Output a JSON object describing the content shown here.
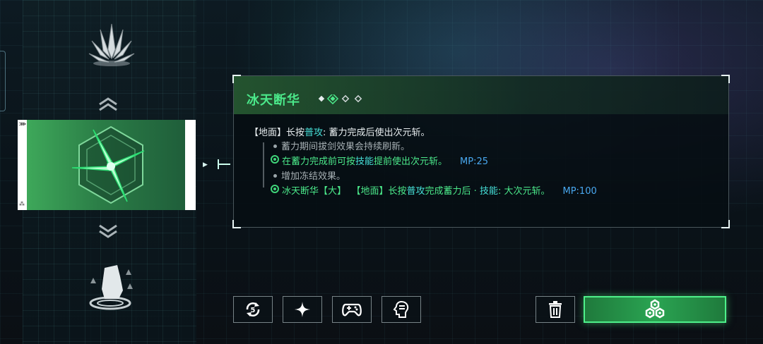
{
  "icons": {
    "crystal": "frost-crystal-icon",
    "skill": "crossed-blades-skill-icon",
    "foot": "dash-foot-icon",
    "chev_up": "chevron-up-icon",
    "chev_down": "chevron-down-icon"
  },
  "skill": {
    "name": "冰天断华",
    "level_markers": 4,
    "active_level": 2
  },
  "description": {
    "l1": {
      "a": "【地面】长按",
      "b": "普攻",
      "c": ": 蓄力完成后使出次元斩。"
    },
    "l2": "蓄力期间拔剑效果会持续刷新。",
    "l3": {
      "a": "在蓄力完成前可按",
      "b": "技能",
      "c": "提前使出次元斩。",
      "mp": "MP:25"
    },
    "l4": "增加冻结效果。",
    "l5": {
      "a": "冰天断华【大】",
      "b": "【地面】长按",
      "c": "普攻",
      "d": "完成蓄力后 · ",
      "e": "技能",
      "f": ": 大次元斩。",
      "mp": "MP:100"
    }
  },
  "card": {
    "marker": "⋙",
    "badge": "⁂"
  },
  "bottom_buttons": [
    {
      "name": "cycle-5-button",
      "icon": "refresh-5-icon",
      "glyph": "5"
    },
    {
      "name": "sparkle-button",
      "icon": "sparkle-icon"
    },
    {
      "name": "gamepad-button",
      "icon": "gamepad-icon"
    },
    {
      "name": "tips-button",
      "icon": "speech-head-icon"
    }
  ],
  "trash_icon": "trash-icon",
  "confirm_icon": "hexagon-cluster-icon",
  "colors": {
    "accent_green": "#4be88a",
    "highlight_cyan": "#46e0d8",
    "mp_blue": "#49a8f0"
  }
}
